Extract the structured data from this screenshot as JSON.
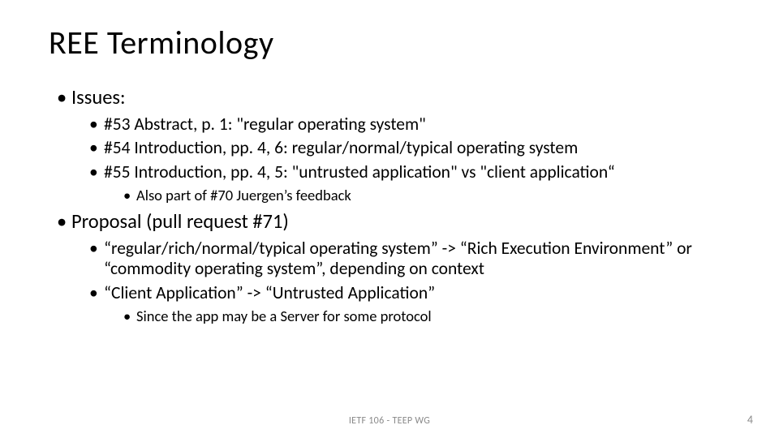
{
  "title": "REE Terminology",
  "issues": {
    "heading": "Issues:",
    "items": [
      "#53 Abstract, p. 1: \"regular operating system\"",
      "#54 Introduction, pp. 4, 6: regular/normal/typical operating system",
      "#55 Introduction, pp. 4, 5: \"untrusted application\" vs \"client application“"
    ],
    "subitem": "Also part of #70 Juergen’s feedback"
  },
  "proposal": {
    "heading": "Proposal (pull request #71)",
    "items": [
      "“regular/rich/normal/typical operating system” -> “Rich Execution Environment” or “commodity operating system”, depending on context",
      "“Client Application” -> “Untrusted Application”"
    ],
    "subitem": "Since the app may be a Server for some protocol"
  },
  "footer": {
    "center": "IETF 106 - TEEP WG",
    "page": "4"
  }
}
